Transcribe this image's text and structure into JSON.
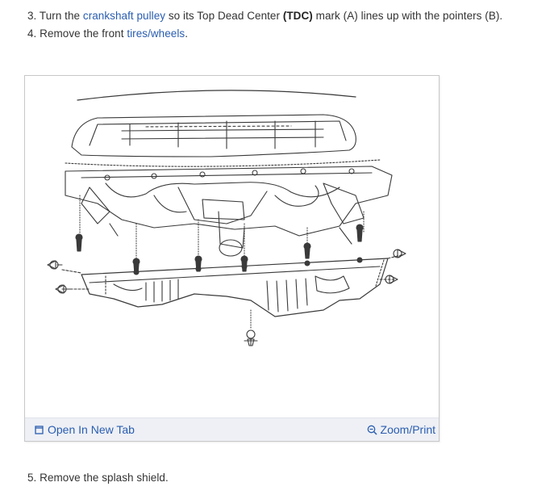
{
  "steps": {
    "step3": {
      "prefix": "3. Turn the ",
      "link": "crankshaft pulley",
      "middle": " so its Top Dead Center ",
      "bold": "(TDC)",
      "suffix": " mark (A) lines up with the pointers (B)."
    },
    "step4": {
      "prefix": "4. Remove the front ",
      "link": "tires/wheels",
      "suffix": "."
    },
    "step5": {
      "text": "5. Remove the splash shield."
    }
  },
  "figure": {
    "open_label": "Open In New Tab",
    "zoom_label": "Zoom/Print",
    "open_icon": "open-new-tab-icon",
    "zoom_icon": "zoom-icon"
  },
  "colors": {
    "link": "#2a5db0",
    "toolbar_bg": "#eef0f5",
    "text": "#333333"
  }
}
